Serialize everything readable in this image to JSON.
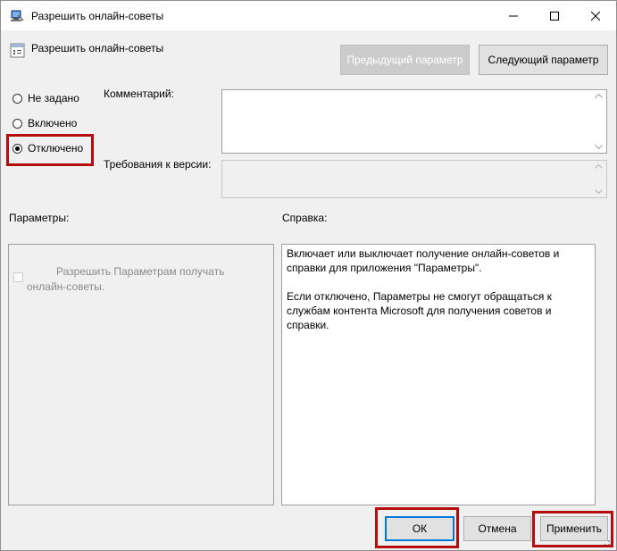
{
  "window": {
    "title": "Разрешить онлайн-советы"
  },
  "policy": {
    "name": "Разрешить онлайн-советы"
  },
  "nav": {
    "prev_label": "Предыдущий параметр",
    "next_label": "Следующий параметр"
  },
  "state": {
    "options": [
      {
        "label": "Не задано",
        "checked": false
      },
      {
        "label": "Включено",
        "checked": false
      },
      {
        "label": "Отключено",
        "checked": true
      }
    ]
  },
  "fields": {
    "comment_label": "Комментарий:",
    "comment_value": "",
    "version_label": "Требования к версии:",
    "version_value": ""
  },
  "panels": {
    "options_label": "Параметры:",
    "help_label": "Справка:",
    "option_checkbox_label": "Разрешить Параметрам получать онлайн-советы.",
    "help_paragraphs": [
      "Включает или выключает получение онлайн-советов и справки для приложения \"Параметры\".",
      "Если отключено, Параметры не смогут обращаться к службам контента Microsoft для получения советов и справки."
    ]
  },
  "footer": {
    "ok_label": "ОК",
    "cancel_label": "Отмена",
    "apply_label": "Применить"
  },
  "colors": {
    "highlight": "#b40d0d",
    "focus": "#0078d7"
  }
}
